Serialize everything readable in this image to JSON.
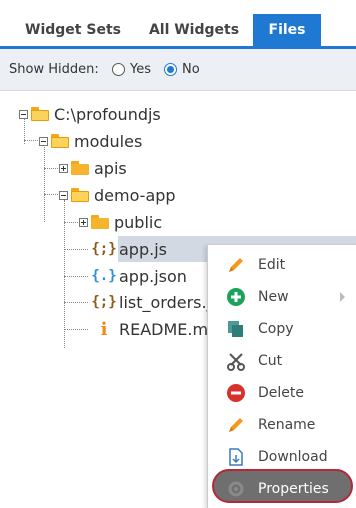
{
  "tabs": [
    {
      "label": "Widget Sets"
    },
    {
      "label": "All Widgets"
    },
    {
      "label": "Files"
    }
  ],
  "options": {
    "show_hidden_label": "Show Hidden:",
    "yes_label": "Yes",
    "no_label": "No",
    "selected": "No"
  },
  "tree": {
    "root": "C:\\profoundjs",
    "modules": "modules",
    "apis": "apis",
    "demo_app": "demo-app",
    "public": "public",
    "app_js": "app.js",
    "app_json": "app.json",
    "list_orders": "list_orders.j",
    "readme": "README.m"
  },
  "menu": {
    "edit": "Edit",
    "new": "New",
    "copy": "Copy",
    "cut": "Cut",
    "delete": "Delete",
    "rename": "Rename",
    "download": "Download",
    "properties": "Properties"
  },
  "colors": {
    "accent": "#1f78d1",
    "folder": "#f7b32b",
    "highlight_ring": "#b4283b"
  }
}
